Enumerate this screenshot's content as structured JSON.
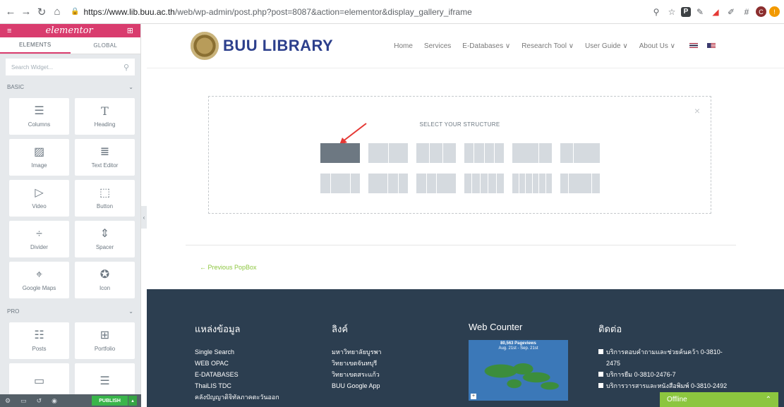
{
  "browser": {
    "url_host": "https://www.lib.buu.ac.th",
    "url_path": "/web/wp-admin/post.php?post=8087&action=elementor&display_gallery_iframe"
  },
  "panel": {
    "logo": "elementor",
    "tabs": [
      "ELEMENTS",
      "GLOBAL"
    ],
    "search_placeholder": "Search Widget...",
    "basic_label": "BASIC",
    "pro_label": "PRO",
    "basic_widgets": [
      {
        "label": "Columns",
        "icon": "columns-icon"
      },
      {
        "label": "Heading",
        "icon": "heading-icon"
      },
      {
        "label": "Image",
        "icon": "image-icon"
      },
      {
        "label": "Text Editor",
        "icon": "text-editor-icon"
      },
      {
        "label": "Video",
        "icon": "video-icon"
      },
      {
        "label": "Button",
        "icon": "button-icon"
      },
      {
        "label": "Divider",
        "icon": "divider-icon"
      },
      {
        "label": "Spacer",
        "icon": "spacer-icon"
      },
      {
        "label": "Google Maps",
        "icon": "map-icon"
      },
      {
        "label": "Icon",
        "icon": "star-icon"
      }
    ],
    "pro_widgets": [
      {
        "label": "Posts",
        "icon": "posts-icon"
      },
      {
        "label": "Portfolio",
        "icon": "portfolio-icon"
      },
      {
        "label": "",
        "icon": "slides-icon"
      },
      {
        "label": "",
        "icon": "form-icon"
      }
    ],
    "publish_label": "PUBLISH"
  },
  "site": {
    "brand": "BUU LIBRARY",
    "menu": [
      "Home",
      "Services",
      "E-Databases ∨",
      "Research Tool ∨",
      "User Guide ∨",
      "About Us ∨"
    ],
    "structure_title": "SELECT YOUR STRUCTURE",
    "prev_link": "← Previous PopBox"
  },
  "footer": {
    "col1": {
      "title": "แหล่งข้อมูล",
      "items": [
        "Single Search",
        "WEB OPAC",
        "E-DATABASES",
        "ThaiLIS TDC",
        "คลังปัญญาดิจิทัลภาคตะวันออก"
      ]
    },
    "col2": {
      "title": "ลิงค์",
      "items": [
        "มหาวิทยาลัยบูรพา",
        "วิทยาเขตจันทบุรี",
        "วิทยาเขตสระแก้ว",
        "BUU Google App"
      ]
    },
    "col3": {
      "title": "Web Counter",
      "counter_line1": "80,563 Pageviews",
      "counter_line2": "Aug. 21st - Sep. 21st"
    },
    "col4": {
      "title": "ติดต่อ",
      "items": [
        "บริการตอบคำถามและช่วยค้นคว้า 0-3810-2475",
        "บริการยืม 0-3810-2476-7",
        "บริการวารสารและหนังสือพิมพ์ 0-3810-2492"
      ]
    },
    "offline": "Offline"
  },
  "colors": {
    "accent": "#d93c6e",
    "footer_bg": "#2c3e50",
    "green": "#8cc63f"
  }
}
